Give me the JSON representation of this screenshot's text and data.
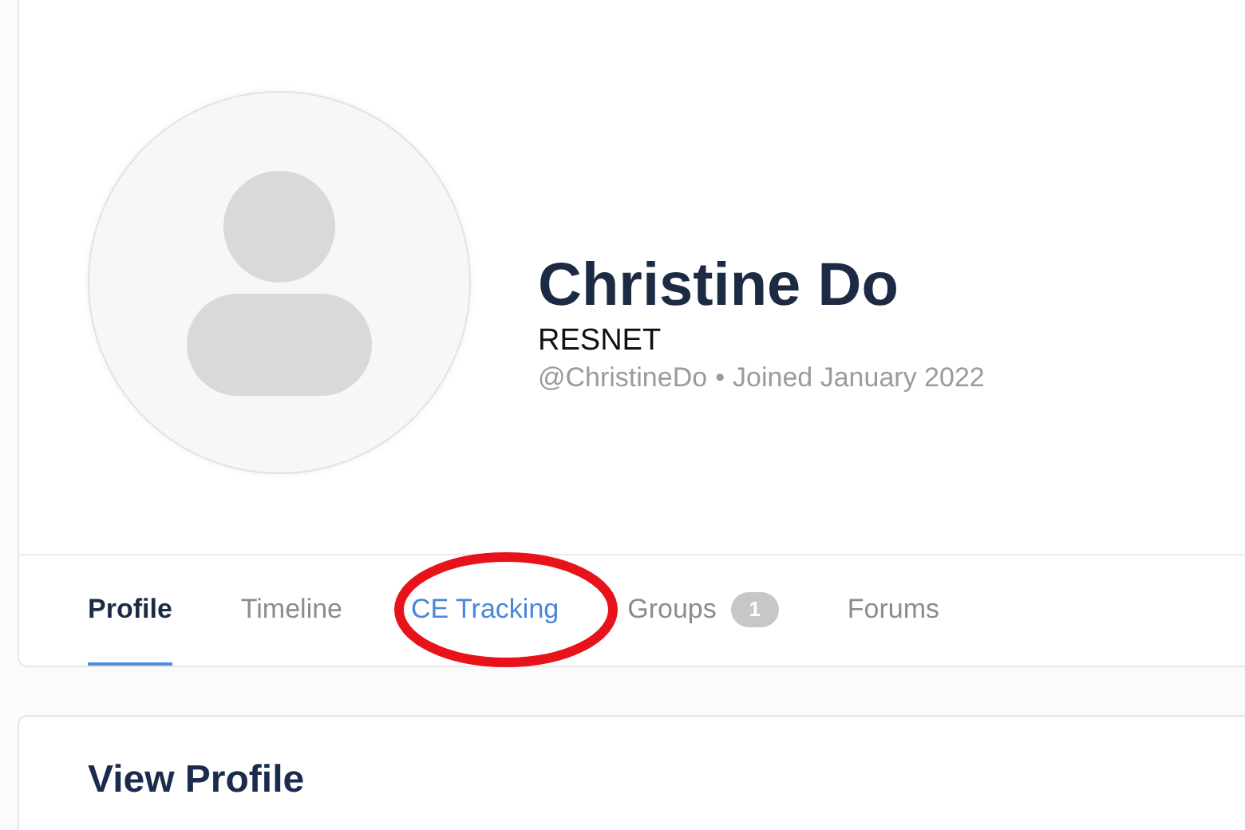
{
  "profile": {
    "name": "Christine Do",
    "organization": "RESNET",
    "handle": "@ChristineDo",
    "separator": "•",
    "joined": "Joined January 2022"
  },
  "tabs": [
    {
      "label": "Profile",
      "selected": true,
      "highlighted": false
    },
    {
      "label": "Timeline",
      "selected": false,
      "highlighted": false
    },
    {
      "label": "CE Tracking",
      "selected": false,
      "highlighted": true
    },
    {
      "label": "Groups",
      "selected": false,
      "highlighted": false,
      "badge": "1"
    },
    {
      "label": "Forums",
      "selected": false,
      "highlighted": false
    }
  ],
  "section": {
    "title": "View Profile"
  }
}
